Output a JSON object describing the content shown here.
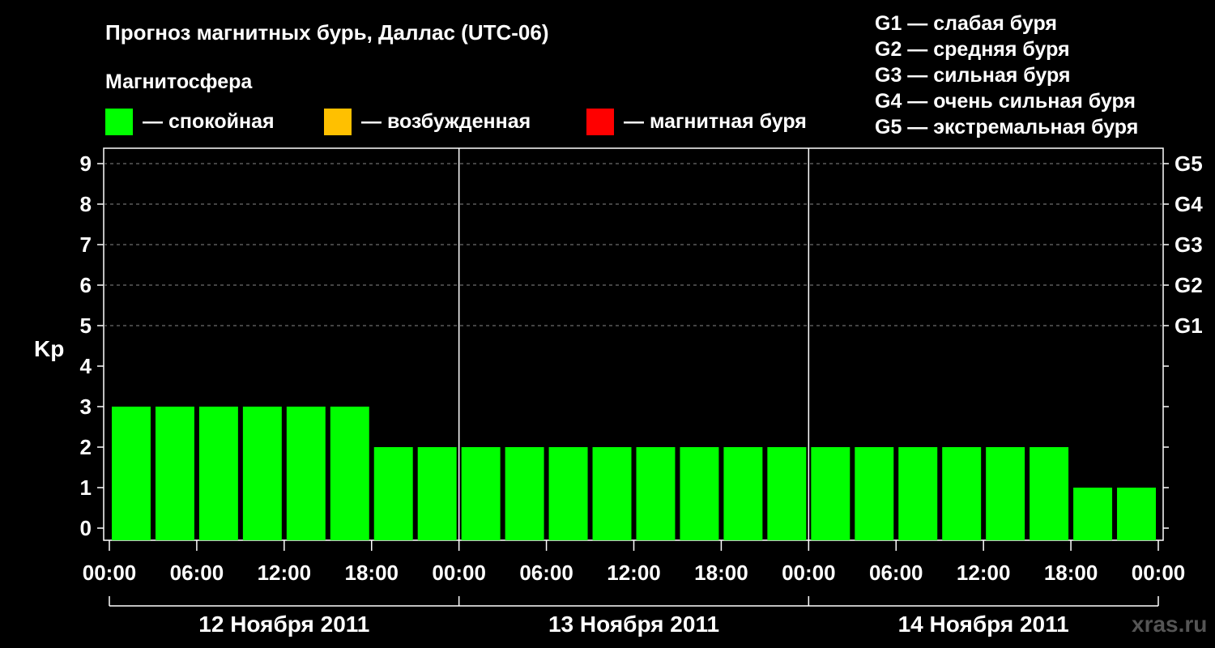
{
  "chart_data": {
    "type": "bar",
    "title": "Прогноз магнитных бурь, Даллас (UTC-06)",
    "ylabel": "Kp",
    "ylim": [
      0,
      9
    ],
    "y_ticks": [
      "0",
      "1",
      "2",
      "3",
      "4",
      "5",
      "6",
      "7",
      "8",
      "9"
    ],
    "right_ticks": [
      {
        "kp": 5,
        "label": "G1"
      },
      {
        "kp": 6,
        "label": "G2"
      },
      {
        "kp": 7,
        "label": "G3"
      },
      {
        "kp": 8,
        "label": "G4"
      },
      {
        "kp": 9,
        "label": "G5"
      }
    ],
    "x_tick_labels": [
      "00:00",
      "06:00",
      "12:00",
      "18:00",
      "00:00",
      "06:00",
      "12:00",
      "18:00",
      "00:00",
      "06:00",
      "12:00",
      "18:00",
      "00:00"
    ],
    "days": [
      "12 Ноября 2011",
      "13 Ноября 2011",
      "14 Ноября 2011"
    ],
    "interval_hours": 3,
    "values": [
      3,
      3,
      3,
      3,
      3,
      3,
      2,
      2,
      2,
      2,
      2,
      2,
      2,
      2,
      2,
      2,
      2,
      2,
      2,
      2,
      2,
      2,
      1,
      1
    ],
    "grid": "dashed horizontal at Kp 5-9",
    "legend": {
      "title": "Магнитосфера",
      "items": [
        {
          "label": "— спокойная",
          "color": "#00ff00"
        },
        {
          "label": "— возбужденная",
          "color": "#ffc000"
        },
        {
          "label": "— магнитная буря",
          "color": "#ff0000"
        }
      ]
    },
    "g_scale": [
      "G1 — слабая буря",
      "G2 — средняя буря",
      "G3 — сильная буря",
      "G4 — очень сильная буря",
      "G5 — экстремальная буря"
    ],
    "watermark": "xras.ru",
    "bar_color": "#00ff00"
  }
}
